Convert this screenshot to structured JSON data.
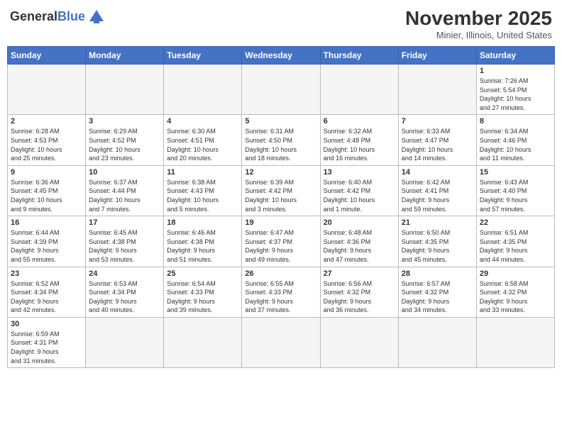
{
  "header": {
    "logo_general": "General",
    "logo_blue": "Blue",
    "month_title": "November 2025",
    "location": "Minier, Illinois, United States"
  },
  "days_of_week": [
    "Sunday",
    "Monday",
    "Tuesday",
    "Wednesday",
    "Thursday",
    "Friday",
    "Saturday"
  ],
  "weeks": [
    [
      {
        "day": "",
        "info": ""
      },
      {
        "day": "",
        "info": ""
      },
      {
        "day": "",
        "info": ""
      },
      {
        "day": "",
        "info": ""
      },
      {
        "day": "",
        "info": ""
      },
      {
        "day": "",
        "info": ""
      },
      {
        "day": "1",
        "info": "Sunrise: 7:26 AM\nSunset: 5:54 PM\nDaylight: 10 hours\nand 27 minutes."
      }
    ],
    [
      {
        "day": "2",
        "info": "Sunrise: 6:28 AM\nSunset: 4:53 PM\nDaylight: 10 hours\nand 25 minutes."
      },
      {
        "day": "3",
        "info": "Sunrise: 6:29 AM\nSunset: 4:52 PM\nDaylight: 10 hours\nand 23 minutes."
      },
      {
        "day": "4",
        "info": "Sunrise: 6:30 AM\nSunset: 4:51 PM\nDaylight: 10 hours\nand 20 minutes."
      },
      {
        "day": "5",
        "info": "Sunrise: 6:31 AM\nSunset: 4:50 PM\nDaylight: 10 hours\nand 18 minutes."
      },
      {
        "day": "6",
        "info": "Sunrise: 6:32 AM\nSunset: 4:48 PM\nDaylight: 10 hours\nand 16 minutes."
      },
      {
        "day": "7",
        "info": "Sunrise: 6:33 AM\nSunset: 4:47 PM\nDaylight: 10 hours\nand 14 minutes."
      },
      {
        "day": "8",
        "info": "Sunrise: 6:34 AM\nSunset: 4:46 PM\nDaylight: 10 hours\nand 11 minutes."
      }
    ],
    [
      {
        "day": "9",
        "info": "Sunrise: 6:36 AM\nSunset: 4:45 PM\nDaylight: 10 hours\nand 9 minutes."
      },
      {
        "day": "10",
        "info": "Sunrise: 6:37 AM\nSunset: 4:44 PM\nDaylight: 10 hours\nand 7 minutes."
      },
      {
        "day": "11",
        "info": "Sunrise: 6:38 AM\nSunset: 4:43 PM\nDaylight: 10 hours\nand 5 minutes."
      },
      {
        "day": "12",
        "info": "Sunrise: 6:39 AM\nSunset: 4:42 PM\nDaylight: 10 hours\nand 3 minutes."
      },
      {
        "day": "13",
        "info": "Sunrise: 6:40 AM\nSunset: 4:42 PM\nDaylight: 10 hours\nand 1 minute."
      },
      {
        "day": "14",
        "info": "Sunrise: 6:42 AM\nSunset: 4:41 PM\nDaylight: 9 hours\nand 59 minutes."
      },
      {
        "day": "15",
        "info": "Sunrise: 6:43 AM\nSunset: 4:40 PM\nDaylight: 9 hours\nand 57 minutes."
      }
    ],
    [
      {
        "day": "16",
        "info": "Sunrise: 6:44 AM\nSunset: 4:39 PM\nDaylight: 9 hours\nand 55 minutes."
      },
      {
        "day": "17",
        "info": "Sunrise: 6:45 AM\nSunset: 4:38 PM\nDaylight: 9 hours\nand 53 minutes."
      },
      {
        "day": "18",
        "info": "Sunrise: 6:46 AM\nSunset: 4:38 PM\nDaylight: 9 hours\nand 51 minutes."
      },
      {
        "day": "19",
        "info": "Sunrise: 6:47 AM\nSunset: 4:37 PM\nDaylight: 9 hours\nand 49 minutes."
      },
      {
        "day": "20",
        "info": "Sunrise: 6:48 AM\nSunset: 4:36 PM\nDaylight: 9 hours\nand 47 minutes."
      },
      {
        "day": "21",
        "info": "Sunrise: 6:50 AM\nSunset: 4:35 PM\nDaylight: 9 hours\nand 45 minutes."
      },
      {
        "day": "22",
        "info": "Sunrise: 6:51 AM\nSunset: 4:35 PM\nDaylight: 9 hours\nand 44 minutes."
      }
    ],
    [
      {
        "day": "23",
        "info": "Sunrise: 6:52 AM\nSunset: 4:34 PM\nDaylight: 9 hours\nand 42 minutes."
      },
      {
        "day": "24",
        "info": "Sunrise: 6:53 AM\nSunset: 4:34 PM\nDaylight: 9 hours\nand 40 minutes."
      },
      {
        "day": "25",
        "info": "Sunrise: 6:54 AM\nSunset: 4:33 PM\nDaylight: 9 hours\nand 39 minutes."
      },
      {
        "day": "26",
        "info": "Sunrise: 6:55 AM\nSunset: 4:33 PM\nDaylight: 9 hours\nand 37 minutes."
      },
      {
        "day": "27",
        "info": "Sunrise: 6:56 AM\nSunset: 4:32 PM\nDaylight: 9 hours\nand 36 minutes."
      },
      {
        "day": "28",
        "info": "Sunrise: 6:57 AM\nSunset: 4:32 PM\nDaylight: 9 hours\nand 34 minutes."
      },
      {
        "day": "29",
        "info": "Sunrise: 6:58 AM\nSunset: 4:32 PM\nDaylight: 9 hours\nand 33 minutes."
      }
    ],
    [
      {
        "day": "30",
        "info": "Sunrise: 6:59 AM\nSunset: 4:31 PM\nDaylight: 9 hours\nand 31 minutes."
      },
      {
        "day": "",
        "info": ""
      },
      {
        "day": "",
        "info": ""
      },
      {
        "day": "",
        "info": ""
      },
      {
        "day": "",
        "info": ""
      },
      {
        "day": "",
        "info": ""
      },
      {
        "day": "",
        "info": ""
      }
    ]
  ]
}
